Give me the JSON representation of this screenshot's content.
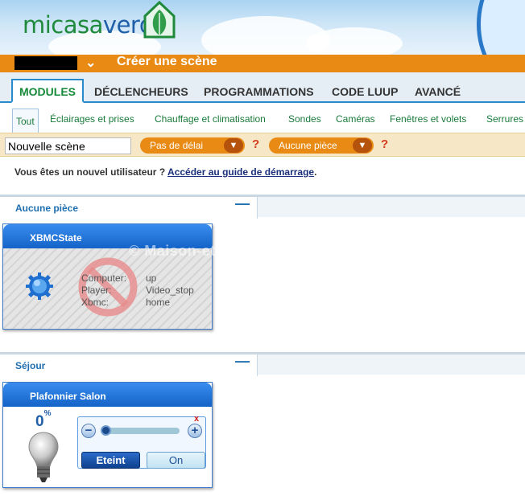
{
  "header": {
    "logo_part1": "micasa",
    "logo_part2": "verde"
  },
  "scene_bar": {
    "title": "Créer une scène"
  },
  "tabs": [
    {
      "label": "MODULES",
      "active": true
    },
    {
      "label": "DÉCLENCHEURS"
    },
    {
      "label": "PROGRAMMATIONS"
    },
    {
      "label": "CODE LUUP"
    },
    {
      "label": "AVANCÉ"
    }
  ],
  "subtabs": [
    {
      "label": "Tout",
      "active": true
    },
    {
      "label": "Éclairages et prises"
    },
    {
      "label": "Chauffage et climatisation"
    },
    {
      "label": "Sondes"
    },
    {
      "label": "Caméras"
    },
    {
      "label": "Fenêtres et volets"
    },
    {
      "label": "Serrures"
    }
  ],
  "filters": {
    "scene_name": "Nouvelle scène",
    "delay": "Pas de délai",
    "room": "Aucune pièce",
    "help": "?"
  },
  "guide": {
    "text": "Vous êtes un nouvel utilisateur ? ",
    "link": "Accéder au guide de démarrage",
    "end": "."
  },
  "rooms": [
    {
      "name": "Aucune pièce",
      "collapse": "—",
      "device": {
        "name": "XBMCState",
        "keys": [
          "Computer:",
          "Player:",
          "Xbmc:"
        ],
        "values": [
          "up",
          "Video_stop",
          "home"
        ]
      }
    },
    {
      "name": "Séjour",
      "collapse": "—",
      "device": {
        "name": "Plafonnier Salon",
        "level": "0",
        "level_unit": "%",
        "minus": "−",
        "plus": "+",
        "close": "x",
        "off_label": "Eteint",
        "on_label": "On"
      }
    }
  ],
  "watermark": "© Maison-et-Domotique.com",
  "colors": {
    "accent_orange": "#e88a13",
    "tab_blue": "#2a8acb",
    "brand_green": "#1f8a3b"
  }
}
